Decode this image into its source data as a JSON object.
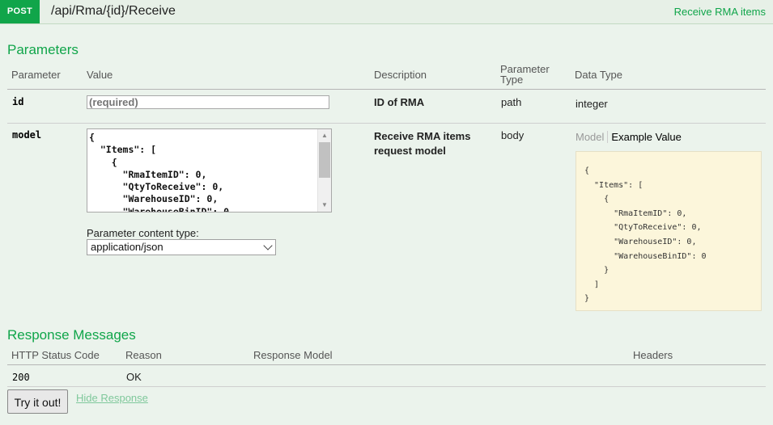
{
  "operation": {
    "method": "POST",
    "path": "/api/Rma/{id}/Receive",
    "summary": "Receive RMA items"
  },
  "parameters": {
    "title": "Parameters",
    "headers": {
      "parameter": "Parameter",
      "value": "Value",
      "description": "Description",
      "parameter_type_line1": "Parameter",
      "parameter_type_line2": "Type",
      "data_type": "Data Type"
    },
    "rows": [
      {
        "name": "id",
        "placeholder": "(required)",
        "description": "ID of RMA",
        "param_type": "path",
        "data_type": "integer"
      },
      {
        "name": "model",
        "value": "{\n  \"Items\": [\n    {\n      \"RmaItemID\": 0,\n      \"QtyToReceive\": 0,\n      \"WarehouseID\": 0,\n      \"WarehouseBinID\": 0\n    }\n  ]\n}",
        "description_line1": "Receive RMA items",
        "description_line2": "request model",
        "param_type": "body",
        "content_type_label": "Parameter content type:",
        "content_type_value": "application/json",
        "model_tab": "Model",
        "example_tab": "Example Value",
        "example_value": "{\n  \"Items\": [\n    {\n      \"RmaItemID\": 0,\n      \"QtyToReceive\": 0,\n      \"WarehouseID\": 0,\n      \"WarehouseBinID\": 0\n    }\n  ]\n}"
      }
    ]
  },
  "responses": {
    "title": "Response Messages",
    "headers": {
      "status": "HTTP Status Code",
      "reason": "Reason",
      "model": "Response Model",
      "headers": "Headers"
    },
    "rows": [
      {
        "status": "200",
        "reason": "OK"
      }
    ]
  },
  "actions": {
    "try_label": "Try it out!",
    "hide_label": "Hide Response"
  },
  "colors": {
    "accent": "#10a54a",
    "background": "#ebf3ec",
    "example_bg": "#fcf6db"
  },
  "icons": [
    "scroll-up-arrow-icon",
    "scroll-down-arrow-icon",
    "chevron-down-icon"
  ]
}
